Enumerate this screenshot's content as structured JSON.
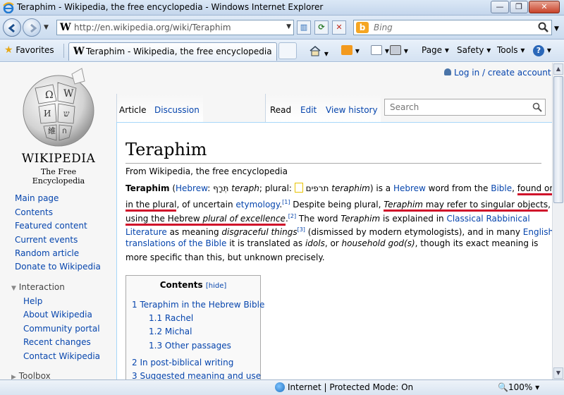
{
  "window": {
    "title": "Teraphim - Wikipedia, the free encyclopedia - Windows Internet Explorer",
    "min": "—",
    "max": "❐",
    "close": "✕"
  },
  "browser": {
    "url": "http://en.wikipedia.org/wiki/Teraphim",
    "search_placeholder": "Bing",
    "favorites_label": "Favorites",
    "tab_title": "Teraphim - Wikipedia, the free encyclopedia",
    "commands": {
      "page": "Page",
      "safety": "Safety",
      "tools": "Tools"
    },
    "status": {
      "zone": "Internet | Protected Mode: On",
      "zoom": "100%"
    }
  },
  "wiki": {
    "logo": {
      "wordmark": "WIKIPEDIA",
      "tagline": "The Free Encyclopedia"
    },
    "login": "Log in / create account",
    "tabs": {
      "article": "Article",
      "discussion": "Discussion",
      "read": "Read",
      "edit": "Edit",
      "history": "View history"
    },
    "search_placeholder": "Search",
    "nav": [
      "Main page",
      "Contents",
      "Featured content",
      "Current events",
      "Random article",
      "Donate to Wikipedia"
    ],
    "interaction": {
      "header": "Interaction",
      "items": [
        "Help",
        "About Wikipedia",
        "Community portal",
        "Recent changes",
        "Contact Wikipedia"
      ]
    },
    "toolbox": "Toolbox",
    "title": "Teraphim",
    "site_sub": "From Wikipedia, the free encyclopedia",
    "para": {
      "l1": {
        "a": "Teraphim",
        "b": " (",
        "c": "Hebrew",
        "d": ": תְּרָף ",
        "e": "teraph",
        "f": "; plural: ",
        "g": " תרפים ",
        "h": "teraphim",
        "i": ") is a ",
        "j": "Hebrew",
        "k": " word from the ",
        "l": "Bible",
        "m": ", ",
        "n": "found only"
      },
      "l2": {
        "a": "in the plural",
        "b": ", of uncertain ",
        "c": "etymology",
        "d": ".",
        "e": "[1]",
        "f": " Despite being plural, ",
        "g": "Teraphim",
        "h": " may refer to singular objects",
        "i": ","
      },
      "l3": {
        "a": "using the Hebrew ",
        "b": "plural of excellence",
        "c": ".",
        "d": "[2]",
        "e": " The word ",
        "f": "Teraphim",
        "g": " is explained in ",
        "h": "Classical Rabbinical"
      },
      "l4": {
        "a": "Literature",
        "b": " as meaning ",
        "c": "disgraceful things",
        "d": "[3]",
        "e": " (dismissed by modern etymologists), and in many ",
        "f": "English"
      },
      "l5": {
        "a": "translations of the Bible",
        "b": " it is translated as ",
        "c": "idols",
        "d": ", or ",
        "e": "household god(s)",
        "f": ", though its exact meaning is"
      },
      "l6": {
        "a": "more specific than this, but unknown precisely."
      }
    },
    "toc": {
      "title": "Contents",
      "hide": "[hide]",
      "items": [
        "1 Teraphim in the Hebrew Bible",
        "1.1 Rachel",
        "1.2 Michal",
        "1.3 Other passages",
        "2 In post-biblical writing",
        "3 Suggested meaning and use"
      ]
    }
  }
}
